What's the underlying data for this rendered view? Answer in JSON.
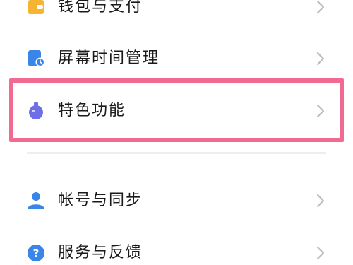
{
  "settings": {
    "items": [
      {
        "label": "钱包与支付",
        "icon": "wallet-icon",
        "icon_color": "#f5b433"
      },
      {
        "label": "屏幕时间管理",
        "icon": "screen-time-icon",
        "icon_color": "#3a86e8"
      },
      {
        "label": "特色功能",
        "icon": "potion-icon",
        "icon_color": "#6e6ee8"
      },
      {
        "label": "帐号与同步",
        "icon": "account-icon",
        "icon_color": "#3a86e8"
      },
      {
        "label": "服务与反馈",
        "icon": "help-icon",
        "icon_color": "#3a86e8"
      }
    ]
  },
  "colors": {
    "highlight": "#f06a91",
    "chevron": "#bdbdbd",
    "divider": "#eeeeee"
  }
}
